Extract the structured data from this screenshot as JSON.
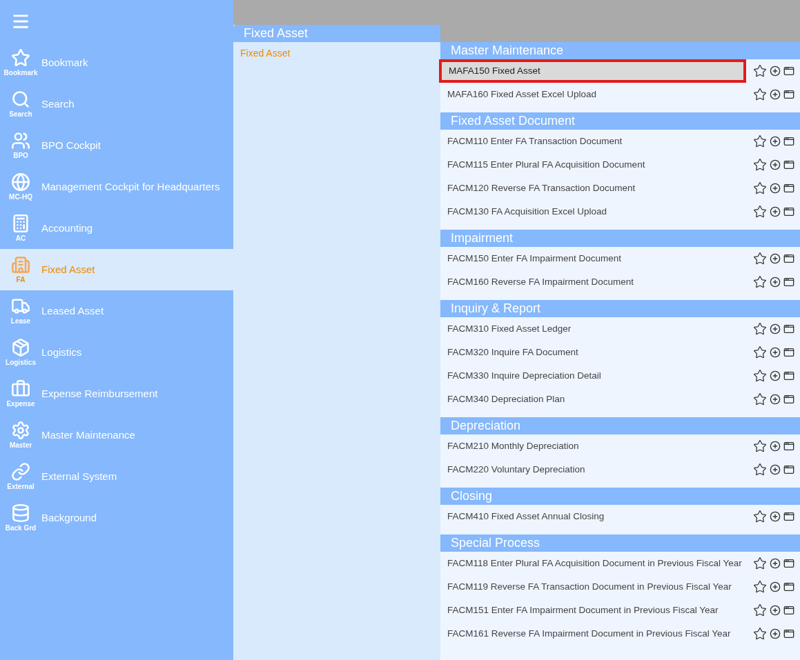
{
  "sidebar": {
    "items": [
      {
        "label": "Bookmark",
        "short": "Bookmark",
        "selected": false
      },
      {
        "label": "Search",
        "short": "Search",
        "selected": false
      },
      {
        "label": "BPO Cockpit",
        "short": "BPO",
        "selected": false
      },
      {
        "label": "Management Cockpit for Headquarters",
        "short": "MC-HQ",
        "selected": false
      },
      {
        "label": "Accounting",
        "short": "AC",
        "selected": false
      },
      {
        "label": "Fixed Asset",
        "short": "FA",
        "selected": true
      },
      {
        "label": "Leased Asset",
        "short": "Lease",
        "selected": false
      },
      {
        "label": "Logistics",
        "short": "Logistics",
        "selected": false
      },
      {
        "label": "Expense Reimbursement",
        "short": "Expense",
        "selected": false
      },
      {
        "label": "Master Maintenance",
        "short": "Master",
        "selected": false
      },
      {
        "label": "External System",
        "short": "External",
        "selected": false
      },
      {
        "label": "Background",
        "short": "Back Grd",
        "selected": false
      }
    ]
  },
  "category_panel": {
    "title": "Fixed Asset",
    "items": [
      {
        "label": "Fixed Asset",
        "selected": true
      }
    ]
  },
  "sections": [
    {
      "title": "Master Maintenance",
      "rows": [
        {
          "label": "MAFA150 Fixed Asset",
          "highlighted": true
        },
        {
          "label": "MAFA160 Fixed Asset Excel Upload",
          "highlighted": false
        }
      ]
    },
    {
      "title": "Fixed Asset Document",
      "rows": [
        {
          "label": "FACM110 Enter FA Transaction Document",
          "highlighted": false
        },
        {
          "label": "FACM115 Enter Plural FA Acquisition Document",
          "highlighted": false
        },
        {
          "label": "FACM120 Reverse FA Transaction Document",
          "highlighted": false
        },
        {
          "label": "FACM130 FA Acquisition Excel Upload",
          "highlighted": false
        }
      ]
    },
    {
      "title": "Impairment",
      "rows": [
        {
          "label": "FACM150 Enter FA Impairment Document",
          "highlighted": false
        },
        {
          "label": "FACM160 Reverse FA Impairment Document",
          "highlighted": false
        }
      ]
    },
    {
      "title": "Inquiry & Report",
      "rows": [
        {
          "label": "FACM310 Fixed Asset Ledger",
          "highlighted": false
        },
        {
          "label": "FACM320 Inquire FA Document",
          "highlighted": false
        },
        {
          "label": "FACM330 Inquire Depreciation Detail",
          "highlighted": false
        },
        {
          "label": "FACM340 Depreciation Plan",
          "highlighted": false
        }
      ]
    },
    {
      "title": "Depreciation",
      "rows": [
        {
          "label": "FACM210 Monthly Depreciation",
          "highlighted": false
        },
        {
          "label": "FACM220 Voluntary Depreciation",
          "highlighted": false
        }
      ]
    },
    {
      "title": "Closing",
      "rows": [
        {
          "label": "FACM410 Fixed Asset Annual Closing",
          "highlighted": false
        }
      ]
    },
    {
      "title": "Special Process",
      "rows": [
        {
          "label": "FACM118 Enter Plural FA Acquisition Document in Previous Fiscal Year",
          "highlighted": false
        },
        {
          "label": "FACM119 Reverse FA Transaction Document in Previous Fiscal Year",
          "highlighted": false
        },
        {
          "label": "FACM151 Enter FA Impairment Document in Previous Fiscal Year",
          "highlighted": false
        },
        {
          "label": "FACM161 Reverse FA Impairment Document in Previous Fiscal Year",
          "highlighted": false
        }
      ]
    }
  ]
}
